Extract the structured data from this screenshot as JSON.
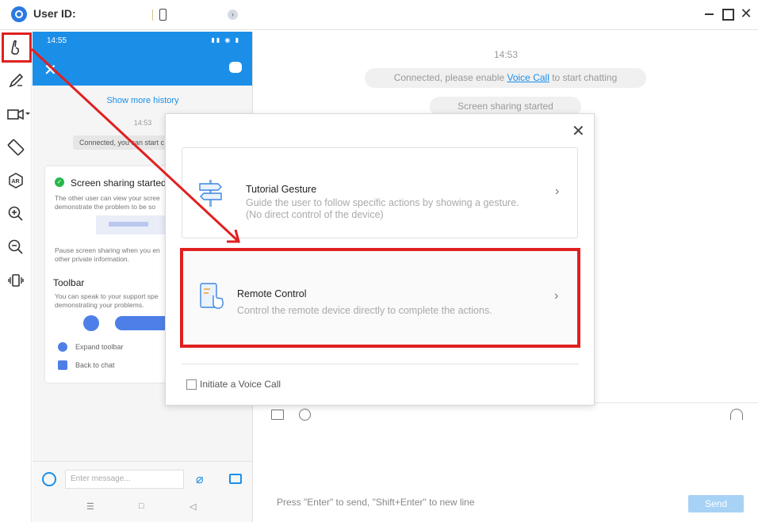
{
  "titlebar": {
    "user_id_label": "User ID:",
    "info_glyph": "›"
  },
  "left_toolbar": {
    "tools": [
      "gesture-icon",
      "pen-icon",
      "video-camera-icon",
      "rotate-icon",
      "ar-icon",
      "zoom-in-icon",
      "zoom-out-icon",
      "vibrate-icon"
    ]
  },
  "phone": {
    "time": "14:55",
    "show_more": "Show more history",
    "msg_time": "14:53",
    "connected_text": "Connected, you can start c",
    "card": {
      "title": "Screen sharing started",
      "line1": "The other user can view your scree",
      "line2": "demonstrate the problem to be so",
      "pause1": "Pause screen sharing when you en",
      "pause2": "other private information.",
      "toolbar_heading": "Toolbar",
      "tb1": "You can speak to your support spe",
      "tb2": "demonstrating your problems.",
      "expand": "Expand toolbar",
      "back": "Back to chat"
    },
    "input_placeholder": "Enter message..."
  },
  "chat": {
    "time": "14:53",
    "connected_prefix": "Connected, please enable ",
    "voice_call_link": "Voice Call",
    "connected_suffix": " to start chatting",
    "screen_sharing": "Screen sharing started",
    "hint": "Press \"Enter\" to send, \"Shift+Enter\" to new line",
    "send_label": "Send"
  },
  "dialog": {
    "close_glyph": "✕",
    "options": [
      {
        "title": "Tutorial Gesture",
        "desc1": "Guide the user to follow specific actions by showing a gesture.",
        "desc2": "(No direct control of the device)"
      },
      {
        "title": "Remote Control",
        "desc1": "Control the remote device directly to complete the actions."
      }
    ],
    "voice_call_label": "Initiate a Voice Call",
    "voice_call_checked": false
  },
  "colors": {
    "accent": "#1b8fe8",
    "annotation": "#e02020"
  }
}
